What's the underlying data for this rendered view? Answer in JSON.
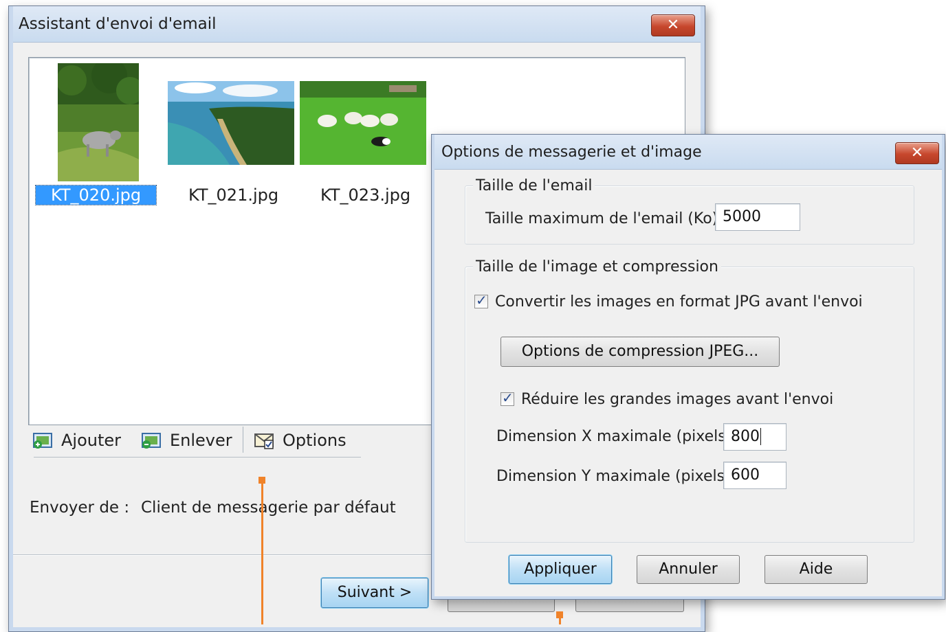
{
  "wizard": {
    "title": "Assistant d'envoi d'email",
    "close_glyph": "✕",
    "thumbnails": [
      {
        "filename": "KT_020.jpg",
        "selected": true,
        "image": "goat-on-grass"
      },
      {
        "filename": "KT_021.jpg",
        "selected": false,
        "image": "coastline-cliff"
      },
      {
        "filename": "KT_023.jpg",
        "selected": false,
        "image": "sheep-and-dog"
      }
    ],
    "toolbar": {
      "add_label": "Ajouter",
      "add_icon": "add-image-icon",
      "remove_label": "Enlever",
      "remove_icon": "remove-image-icon",
      "options_label": "Options",
      "options_icon": "mail-options-icon"
    },
    "send_from_label": "Envoyer de :",
    "send_from_value": "Client de messagerie par défaut",
    "next_button": "Suivant >"
  },
  "options_dialog": {
    "title": "Options de messagerie et d'image",
    "close_glyph": "✕",
    "email_size": {
      "group_label": "Taille de l'email",
      "max_size_label": "Taille maximum de l'email (Ko) :",
      "max_size_value": "5000"
    },
    "image_size": {
      "group_label": "Taille de l'image et compression",
      "convert_jpg_label": "Convertir les images en format JPG avant l'envoi",
      "convert_jpg_checked": true,
      "compression_button": "Options de compression JPEG...",
      "reduce_label": "Réduire les grandes images avant l'envoi",
      "reduce_checked": true,
      "max_x_label": "Dimension X maximale (pixels) :",
      "max_x_value": "800",
      "max_y_label": "Dimension Y maximale (pixels) :",
      "max_y_value": "600"
    },
    "buttons": {
      "apply": "Appliquer",
      "cancel": "Annuler",
      "help": "Aide"
    },
    "check_glyph": "✓"
  },
  "colors": {
    "selection": "#3399ff",
    "callout": "#f0832a",
    "title_bar": "#c9dbef"
  }
}
